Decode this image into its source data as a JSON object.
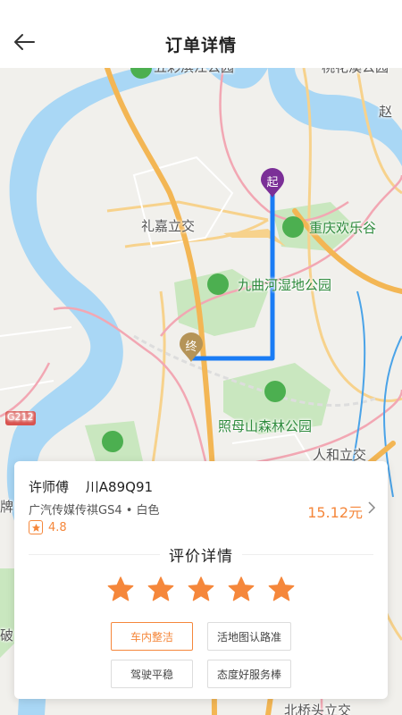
{
  "header": {
    "title": "订单详情",
    "back_icon": "arrow-left-icon"
  },
  "map": {
    "labels": {
      "park_top": "五彩滨江公园",
      "top_right": "桃花溪公园",
      "zhao": "赵",
      "lijia": "礼嘉立交",
      "happy_valley": "重庆欢乐谷",
      "jiuqu": "九曲河湿地公园",
      "zhaomu": "照母山森林公园",
      "renhe": "人和立交",
      "g212": "G212",
      "pai": "牌",
      "po": "破",
      "bottom": "北桥头立交"
    },
    "start_marker": "起",
    "end_marker": "终",
    "colors": {
      "route": "#1a7cf5",
      "start": "#7b2f97",
      "end": "#b59458",
      "river": "#a9d7f5",
      "road_major": "#f3b654",
      "road_minor": "#f7d28c",
      "park": "#c9e7bf",
      "pink_road": "#f2a7b3"
    }
  },
  "driver": {
    "name": "许师傅",
    "plate": "川A89Q91",
    "car": "广汽传媒传祺GS4 • 白色",
    "rating": "4.8",
    "price": "15.12元"
  },
  "evaluation": {
    "title": "评价详情",
    "stars": 5,
    "star_color": "#f5873b",
    "tags": [
      {
        "label": "车内整洁",
        "active": true
      },
      {
        "label": "活地图认路准",
        "active": false
      },
      {
        "label": "驾驶平稳",
        "active": false
      },
      {
        "label": "态度好服务棒",
        "active": false
      }
    ]
  }
}
